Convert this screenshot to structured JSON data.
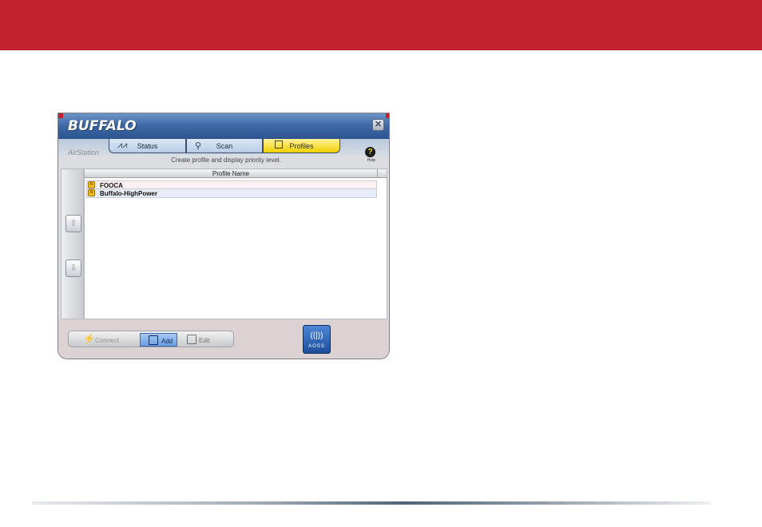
{
  "window": {
    "brand": "BUFFALO",
    "close_glyph": "✕",
    "subbrand": "AirStation",
    "info_text": "Create profile and display priority level.",
    "help_label": "Help",
    "help_glyph": "?"
  },
  "tabs": [
    {
      "label": "Status",
      "icon": "status-wave-icon",
      "active": false
    },
    {
      "label": "Scan",
      "icon": "search-icon",
      "active": false
    },
    {
      "label": "Profiles",
      "icon": "profile-list-icon",
      "active": true
    }
  ],
  "profile_table": {
    "column_header": "Profile Name",
    "rows": [
      {
        "name": "FOOCA",
        "icon": "access-point-icon"
      },
      {
        "name": "Buffalo-HighPower",
        "icon": "access-point-icon"
      }
    ]
  },
  "priority_controls": {
    "up_glyph": "⇧",
    "down_glyph": "⇩"
  },
  "toolbar": {
    "connect_label": "Connect",
    "add_label": "Add",
    "edit_label": "Edit",
    "aoss_label": "AOSS"
  },
  "colors": {
    "banner": "#c1202d",
    "titlebar": "#3f6aa6",
    "active_tab": "#f2d000",
    "add_button": "#6c9fe0"
  }
}
